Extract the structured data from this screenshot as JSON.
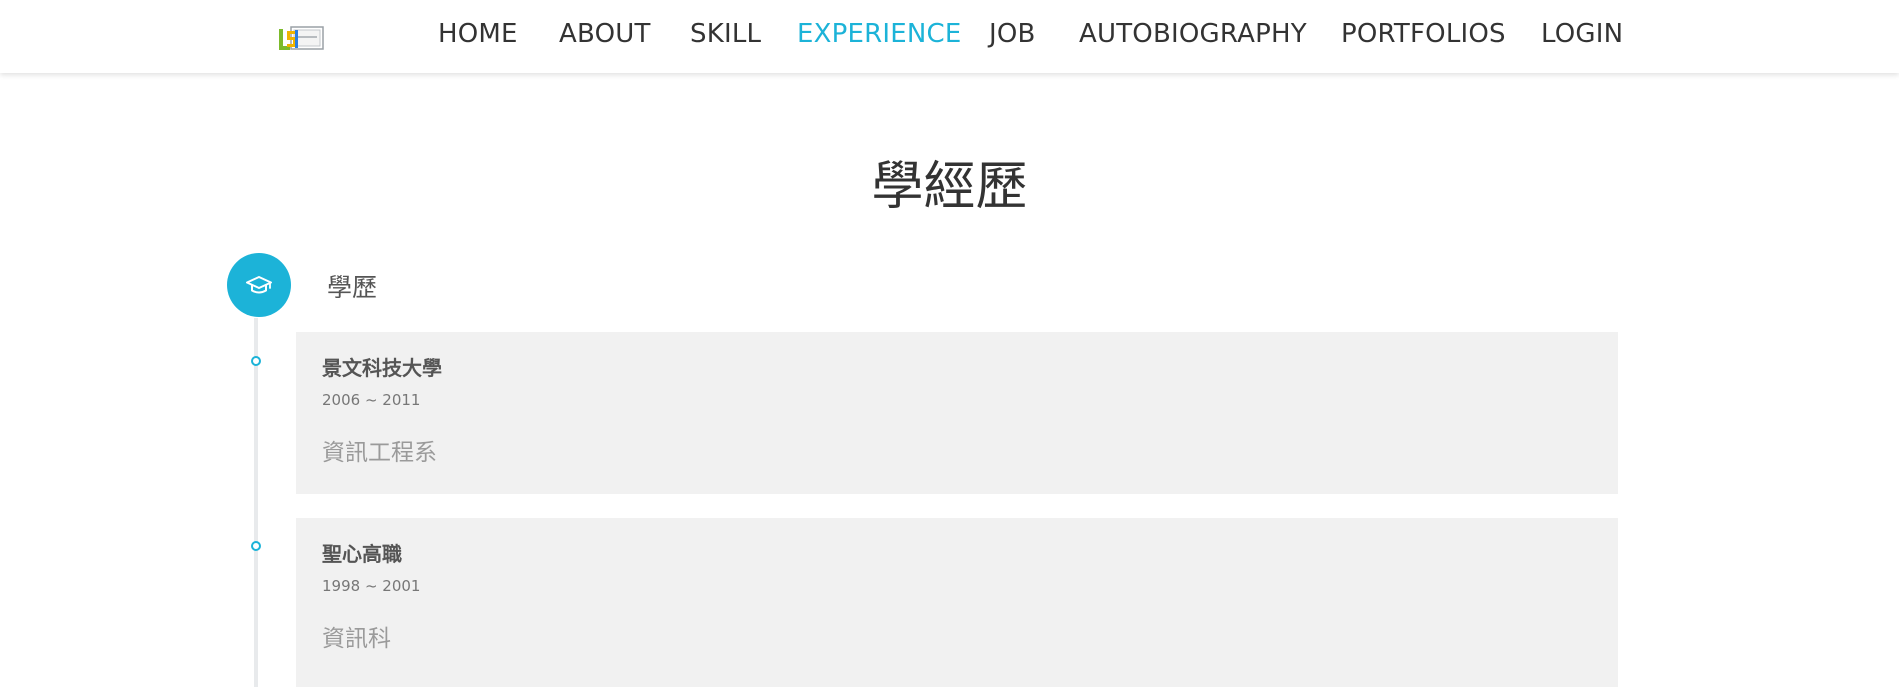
{
  "header": {
    "logo_alt": "LS",
    "nav": [
      {
        "label": "HOME",
        "active": false
      },
      {
        "label": "ABOUT",
        "active": false
      },
      {
        "label": "SKILL",
        "active": false
      },
      {
        "label": "EXPERIENCE",
        "active": true
      },
      {
        "label": "JOB",
        "active": false
      },
      {
        "label": "AUTOBIOGRAPHY",
        "active": false
      },
      {
        "label": "PORTFOLIOS",
        "active": false
      },
      {
        "label": "LOGIN",
        "active": false
      }
    ]
  },
  "page": {
    "title": "學經歷"
  },
  "education": {
    "section_title": "學歷",
    "icon": "graduation-cap-icon",
    "items": [
      {
        "school": "景文科技大學",
        "period": "2006 ~ 2011",
        "department": "資訊工程系"
      },
      {
        "school": "聖心高職",
        "period": "1998 ~ 2001",
        "department": "資訊科"
      }
    ]
  },
  "colors": {
    "accent": "#1cb3d8",
    "text": "#333333",
    "card_bg": "#f1f1f1"
  }
}
